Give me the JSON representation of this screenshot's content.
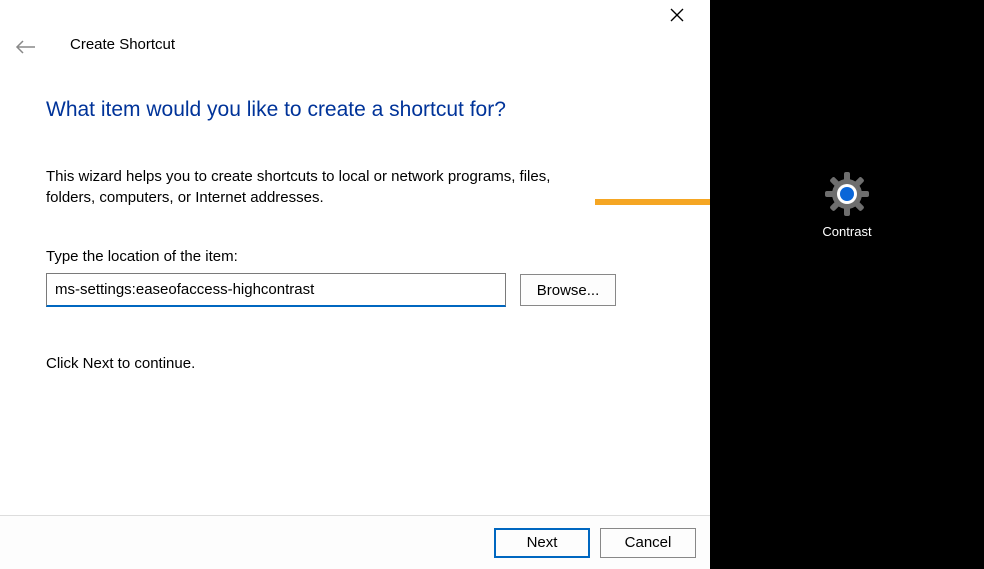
{
  "window": {
    "title": "Create Shortcut"
  },
  "heading": "What item would you like to create a shortcut for?",
  "description": "This wizard helps you to create shortcuts to local or network programs, files, folders, computers, or Internet addresses.",
  "field_label": "Type the location of the item:",
  "location_value": "ms-settings:easeofaccess-highcontrast",
  "browse_label": "Browse...",
  "continue_hint": "Click Next to continue.",
  "footer": {
    "next": "Next",
    "cancel": "Cancel"
  },
  "desktop": {
    "shortcut_label": "Contrast"
  },
  "colors": {
    "accent": "#0067c0",
    "heading": "#003399",
    "arrow": "#f5a623"
  }
}
